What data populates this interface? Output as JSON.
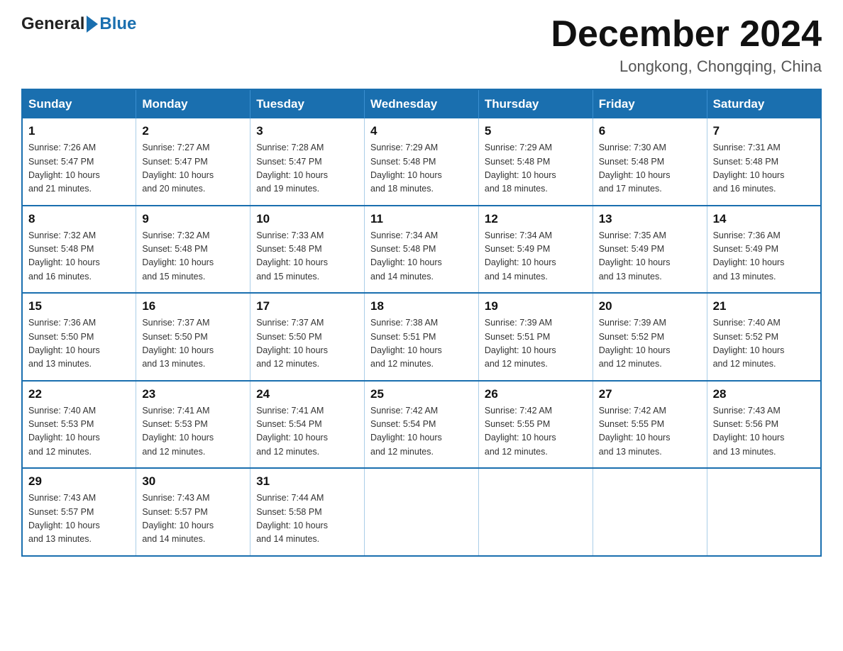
{
  "logo": {
    "general": "General",
    "blue": "Blue"
  },
  "header": {
    "month_title": "December 2024",
    "location": "Longkong, Chongqing, China"
  },
  "days_of_week": [
    "Sunday",
    "Monday",
    "Tuesday",
    "Wednesday",
    "Thursday",
    "Friday",
    "Saturday"
  ],
  "weeks": [
    [
      {
        "day": "1",
        "info": "Sunrise: 7:26 AM\nSunset: 5:47 PM\nDaylight: 10 hours\nand 21 minutes."
      },
      {
        "day": "2",
        "info": "Sunrise: 7:27 AM\nSunset: 5:47 PM\nDaylight: 10 hours\nand 20 minutes."
      },
      {
        "day": "3",
        "info": "Sunrise: 7:28 AM\nSunset: 5:47 PM\nDaylight: 10 hours\nand 19 minutes."
      },
      {
        "day": "4",
        "info": "Sunrise: 7:29 AM\nSunset: 5:48 PM\nDaylight: 10 hours\nand 18 minutes."
      },
      {
        "day": "5",
        "info": "Sunrise: 7:29 AM\nSunset: 5:48 PM\nDaylight: 10 hours\nand 18 minutes."
      },
      {
        "day": "6",
        "info": "Sunrise: 7:30 AM\nSunset: 5:48 PM\nDaylight: 10 hours\nand 17 minutes."
      },
      {
        "day": "7",
        "info": "Sunrise: 7:31 AM\nSunset: 5:48 PM\nDaylight: 10 hours\nand 16 minutes."
      }
    ],
    [
      {
        "day": "8",
        "info": "Sunrise: 7:32 AM\nSunset: 5:48 PM\nDaylight: 10 hours\nand 16 minutes."
      },
      {
        "day": "9",
        "info": "Sunrise: 7:32 AM\nSunset: 5:48 PM\nDaylight: 10 hours\nand 15 minutes."
      },
      {
        "day": "10",
        "info": "Sunrise: 7:33 AM\nSunset: 5:48 PM\nDaylight: 10 hours\nand 15 minutes."
      },
      {
        "day": "11",
        "info": "Sunrise: 7:34 AM\nSunset: 5:48 PM\nDaylight: 10 hours\nand 14 minutes."
      },
      {
        "day": "12",
        "info": "Sunrise: 7:34 AM\nSunset: 5:49 PM\nDaylight: 10 hours\nand 14 minutes."
      },
      {
        "day": "13",
        "info": "Sunrise: 7:35 AM\nSunset: 5:49 PM\nDaylight: 10 hours\nand 13 minutes."
      },
      {
        "day": "14",
        "info": "Sunrise: 7:36 AM\nSunset: 5:49 PM\nDaylight: 10 hours\nand 13 minutes."
      }
    ],
    [
      {
        "day": "15",
        "info": "Sunrise: 7:36 AM\nSunset: 5:50 PM\nDaylight: 10 hours\nand 13 minutes."
      },
      {
        "day": "16",
        "info": "Sunrise: 7:37 AM\nSunset: 5:50 PM\nDaylight: 10 hours\nand 13 minutes."
      },
      {
        "day": "17",
        "info": "Sunrise: 7:37 AM\nSunset: 5:50 PM\nDaylight: 10 hours\nand 12 minutes."
      },
      {
        "day": "18",
        "info": "Sunrise: 7:38 AM\nSunset: 5:51 PM\nDaylight: 10 hours\nand 12 minutes."
      },
      {
        "day": "19",
        "info": "Sunrise: 7:39 AM\nSunset: 5:51 PM\nDaylight: 10 hours\nand 12 minutes."
      },
      {
        "day": "20",
        "info": "Sunrise: 7:39 AM\nSunset: 5:52 PM\nDaylight: 10 hours\nand 12 minutes."
      },
      {
        "day": "21",
        "info": "Sunrise: 7:40 AM\nSunset: 5:52 PM\nDaylight: 10 hours\nand 12 minutes."
      }
    ],
    [
      {
        "day": "22",
        "info": "Sunrise: 7:40 AM\nSunset: 5:53 PM\nDaylight: 10 hours\nand 12 minutes."
      },
      {
        "day": "23",
        "info": "Sunrise: 7:41 AM\nSunset: 5:53 PM\nDaylight: 10 hours\nand 12 minutes."
      },
      {
        "day": "24",
        "info": "Sunrise: 7:41 AM\nSunset: 5:54 PM\nDaylight: 10 hours\nand 12 minutes."
      },
      {
        "day": "25",
        "info": "Sunrise: 7:42 AM\nSunset: 5:54 PM\nDaylight: 10 hours\nand 12 minutes."
      },
      {
        "day": "26",
        "info": "Sunrise: 7:42 AM\nSunset: 5:55 PM\nDaylight: 10 hours\nand 12 minutes."
      },
      {
        "day": "27",
        "info": "Sunrise: 7:42 AM\nSunset: 5:55 PM\nDaylight: 10 hours\nand 13 minutes."
      },
      {
        "day": "28",
        "info": "Sunrise: 7:43 AM\nSunset: 5:56 PM\nDaylight: 10 hours\nand 13 minutes."
      }
    ],
    [
      {
        "day": "29",
        "info": "Sunrise: 7:43 AM\nSunset: 5:57 PM\nDaylight: 10 hours\nand 13 minutes."
      },
      {
        "day": "30",
        "info": "Sunrise: 7:43 AM\nSunset: 5:57 PM\nDaylight: 10 hours\nand 14 minutes."
      },
      {
        "day": "31",
        "info": "Sunrise: 7:44 AM\nSunset: 5:58 PM\nDaylight: 10 hours\nand 14 minutes."
      },
      {
        "day": "",
        "info": ""
      },
      {
        "day": "",
        "info": ""
      },
      {
        "day": "",
        "info": ""
      },
      {
        "day": "",
        "info": ""
      }
    ]
  ]
}
